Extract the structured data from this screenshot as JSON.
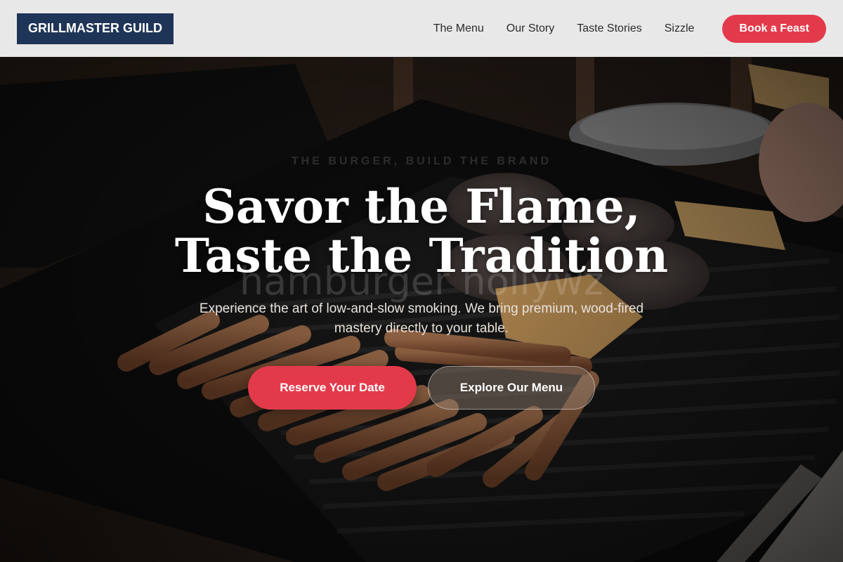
{
  "brand": {
    "name": "GRILLMASTER GUILD"
  },
  "nav": {
    "links": [
      {
        "label": "The Menu"
      },
      {
        "label": "Our Story"
      },
      {
        "label": "Taste Stories"
      },
      {
        "label": "Sizzle"
      }
    ],
    "cta_label": "Book a Feast"
  },
  "hero": {
    "eyebrow": "THE BURGER, BUILD THE BRAND",
    "watermark": "hamburger hollywz",
    "headline": "Savor the Flame, Taste the Tradition",
    "subtext": "Experience the art of low-and-slow smoking. We bring premium, wood-fired mastery directly to your table.",
    "primary_cta": "Reserve Your Date",
    "secondary_cta": "Explore Our Menu",
    "background_image": "grill-with-burgers-and-hot-dogs"
  },
  "colors": {
    "accent": "#e33a4b",
    "logo_bg": "#1f3557",
    "header_bg": "#f0f0f0"
  }
}
